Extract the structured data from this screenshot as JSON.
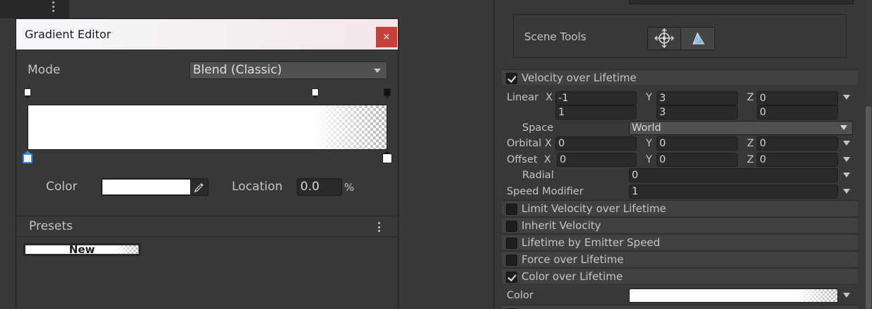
{
  "gradient_editor": {
    "title": "Gradient Editor",
    "close_glyph": "×",
    "mode_label": "Mode",
    "mode_value": "Blend (Classic)",
    "color_label": "Color",
    "color_value": "#FFFFFF",
    "location_label": "Location",
    "location_value": "0.0",
    "location_unit": "%",
    "presets_label": "Presets",
    "preset_new_label": "New",
    "alpha_keys": [
      "#ffffff",
      "#ffffff",
      "#111111"
    ],
    "color_keys": [
      "#ffffff",
      "#ffffff"
    ],
    "selected_color_key": 0
  },
  "inspector": {
    "scene_tools_label": "Scene Tools",
    "scene_tool_icons": [
      "move-tool-icon",
      "shape-tool-icon"
    ],
    "velocity_module": {
      "label": "Velocity over Lifetime",
      "enabled": true,
      "linear_label": "Linear",
      "x_label": "X",
      "y_label": "Y",
      "z_label": "Z",
      "linear_min": [
        "-1",
        "3",
        "0"
      ],
      "linear_max": [
        "1",
        "3",
        "0"
      ],
      "space_label": "Space",
      "space_value": "World",
      "orbital_label": "Orbital X",
      "orbital": [
        "0",
        "0",
        "0"
      ],
      "offset_label": "Offset  X",
      "offset": [
        "0",
        "0",
        "0"
      ],
      "radial_label": "Radial",
      "radial_value": "0",
      "speed_modifier_label": "Speed Modifier",
      "speed_modifier_value": "1"
    },
    "modules": [
      {
        "label": "Limit Velocity over Lifetime",
        "enabled": false
      },
      {
        "label": "Inherit Velocity",
        "enabled": false
      },
      {
        "label": "Lifetime by Emitter Speed",
        "enabled": false
      },
      {
        "label": "Force over Lifetime",
        "enabled": false
      },
      {
        "label": "Color over Lifetime",
        "enabled": true
      }
    ],
    "color_label": "Color"
  },
  "colors": {
    "panel_bg": "#383838",
    "close_red": "#c4413c",
    "selected_key_blue": "#3a8be0"
  }
}
